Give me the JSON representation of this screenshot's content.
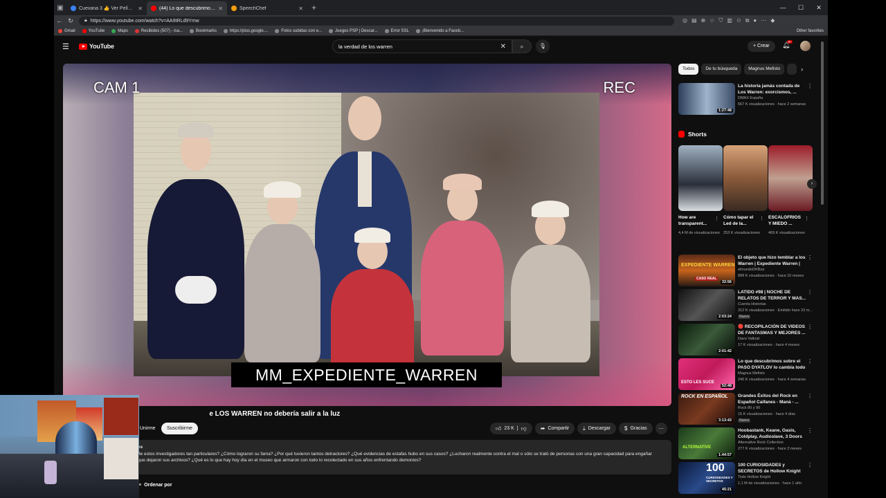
{
  "browser": {
    "tabs": [
      {
        "label": "Cuevana 3 👍 Ver Películas o Se...",
        "active": false,
        "color": "#3b82f6"
      },
      {
        "label": "(44) Lo que descubrimos sob...",
        "active": true,
        "color": "#ff0000"
      },
      {
        "label": "SpeechChef",
        "active": false,
        "color": "#f59e0b"
      }
    ],
    "new_tab": "+",
    "url": "https://www.youtube.com/watch?v=AA9tRLd9Ymw",
    "bookmarks": [
      "Gmail",
      "YouTube",
      "Maps",
      "Recibidos (507) - isa...",
      "Bookmarks",
      "https://plus.google....",
      "Fotos subidas con e...",
      "Juegos PSP | Descar...",
      "Error SSL",
      "¡Bienvenido a Faceb..."
    ],
    "other_favorites": "Other favorites"
  },
  "youtube": {
    "logo_text": "YouTube",
    "search_value": "la verdad de los warren",
    "create_label": "Crear",
    "notification_count": "9+"
  },
  "video": {
    "cam_label": "CAM 1",
    "rec_label": "REC",
    "caption": "MM_EXPEDIENTE_WARREN",
    "title_visible": "e LOS WARREN no debería salir a la luz",
    "join_label": "Unirme",
    "subscribe_label": "Suscribirme",
    "likes": "23 K",
    "share_label": "Compartir",
    "download_label": "Descargar",
    "thanks_label": "Gracias",
    "description_top": "es",
    "description_line1": "de estos investigadores tan particulares? ¿Cómo lograron su fama? ¿Por qué tuvieron tantos detractores? ¿Qué evidencias de estafas hubo en sus casos? ¿Lucharon realmente contra el mal o sólo se trató de personas con una gran capacidad para engañar",
    "description_line2": "que dejaron sus archivos? ¿Qué es lo que hay hoy día en el museo que armaron con todo lo recolectado en sus años enfrentando demonios?",
    "sort_label": "Ordenar por"
  },
  "chips": [
    "Todos",
    "De tu búsqueda",
    "Magnus Mefisto"
  ],
  "shorts_heading": "Shorts",
  "recommendations_top": [
    {
      "title": "La historia jamás contada de Los Warren: exorcismos, ...",
      "channel": "DMAX España",
      "meta": "567 K visualizaciones · hace 2 semanas",
      "duration": "1:27:48",
      "badge": ""
    }
  ],
  "shorts": [
    {
      "title": "How are transparent...",
      "views": "4,4 M de visualizaciones"
    },
    {
      "title": "Cómo tapar el Led de la...",
      "views": "253 K visualizaciones"
    },
    {
      "title": "ESCALOFRIOS Y MIEDO ...",
      "views": "469 K visualizaciones"
    }
  ],
  "recommendations": [
    {
      "title": "El objeto que hizo temblar a los Warren | Expediente Warren | E...",
      "channel": "elmundoDKBza",
      "meta": "898 K visualizaciones · hace 10 meses",
      "duration": "32:56",
      "badge": ""
    },
    {
      "title": "LATIDO #98 | NOCHE DE RELATOS DE TERROR Y MAS...",
      "channel": "Cuenta Historias",
      "meta": "312 K visualizaciones · Emitido hace 23 m...",
      "duration": "2:03:24",
      "badge": "Nuevo"
    },
    {
      "title": "🔴 RECOPILACIÓN DE VIDEOS DE FANTASMAS Y MEJORES ...",
      "channel": "Davo Valkrat",
      "meta": "17 K visualizaciones · hace 4 meses",
      "duration": "2:01:42",
      "badge": ""
    },
    {
      "title": "Lo que descubrimos sobre el PASO DYATLOV lo cambia todo",
      "channel": "Magnus Mefisto",
      "meta": "246 K visualizaciones · hace 4 semanas",
      "duration": "52:48",
      "badge": ""
    },
    {
      "title": "Grandes Éxitos del Rock en Español Caifanes - Maná - ...",
      "channel": "Rock 80 y 90",
      "meta": "15 K visualizaciones · hace 4 días",
      "duration": "3:13:43",
      "badge": "Nuevo"
    },
    {
      "title": "Hoobastank, Keane, Oasis, Coldplay, Audioslave, 3 Doors ...",
      "channel": "Alternative Rock Collection",
      "meta": "277 K visualizaciones · hace 3 meses",
      "duration": "1:44:57",
      "badge": ""
    },
    {
      "title": "100 CURIOSIDADES y SECRETOS de Hollow Knight",
      "channel": "Todo Hollow Knight",
      "meta": "1,1 M de visualizaciones · hace 1 año",
      "duration": "45:21",
      "badge": ""
    }
  ],
  "thumb_texts": {
    "t4": "ESTO LES SUCE",
    "t5": "ROCK EN ESPAÑOL",
    "t6": "ALTERNATIVE",
    "t7": "100",
    "t7b": "CURIOSIDADES Y SECRETOS",
    "t1": "EXPEDIENTE WARREN",
    "t1b": "CASO REAL"
  },
  "colors": {
    "accent": "#ff0000",
    "bg": "#0f0f0f",
    "chip": "#272727"
  }
}
